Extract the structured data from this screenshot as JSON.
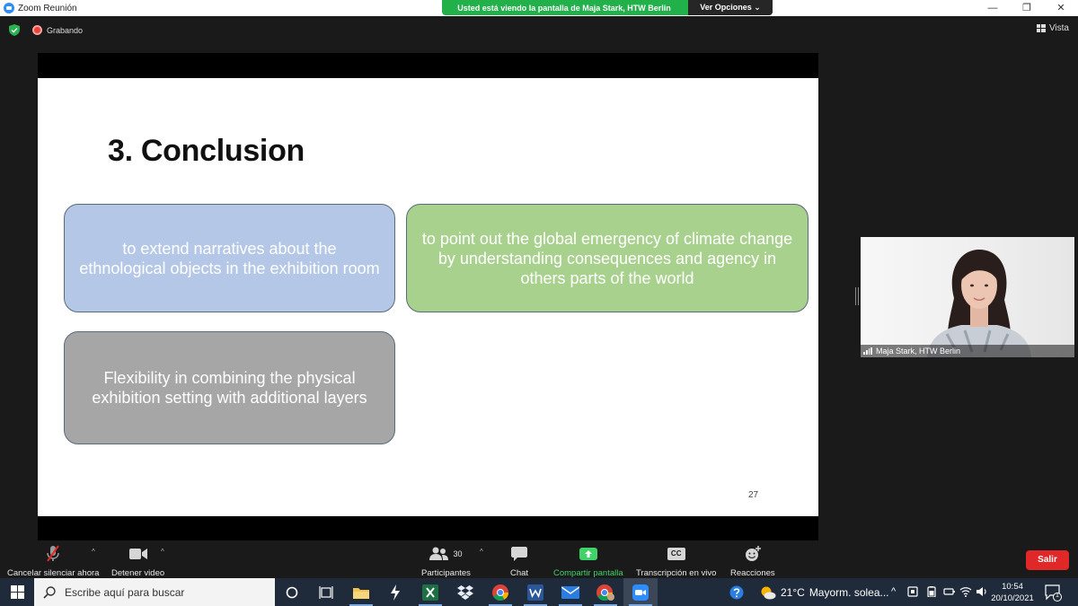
{
  "window": {
    "title": "Zoom Reunión",
    "minimize": "—",
    "maximize": "❐",
    "close": "✕"
  },
  "share_banner": {
    "text": "Usted está viendo la pantalla de Maja Stark, HTW Berlin",
    "options_label": "Ver Opciones ⌄"
  },
  "status": {
    "recording_label": "Grabando",
    "view_label": "Vista"
  },
  "slide": {
    "title": "3. Conclusion",
    "box1": "to extend narratives about the ethnological objects in the exhibition room",
    "box2": "to point out the global emergency of climate change by understanding consequences and agency in others parts of the world",
    "box3": "Flexibility in combining the physical exhibition setting with additional layers",
    "page_number": "27",
    "colors": {
      "box1": "#b4c7e7",
      "box2": "#a9d18e",
      "box3": "#a6a6a6"
    }
  },
  "video": {
    "participant_name": "Maja Stark, HTW Berlin"
  },
  "toolbar": {
    "unmute": "Cancelar silenciar ahora",
    "stop_video": "Detener video",
    "participants": "Participantes",
    "participants_count": "30",
    "chat": "Chat",
    "share": "Compartir pantalla",
    "captions": "Transcripción en vivo",
    "captions_badge": "CC",
    "reactions": "Reacciones",
    "leave": "Salir",
    "caret": "^"
  },
  "taskbar": {
    "search_placeholder": "Escribe aquí para buscar",
    "weather_temp": "21°C",
    "weather_desc": "Mayorm. solea...",
    "time": "10:54",
    "date": "20/10/2021",
    "notifications": "1"
  }
}
